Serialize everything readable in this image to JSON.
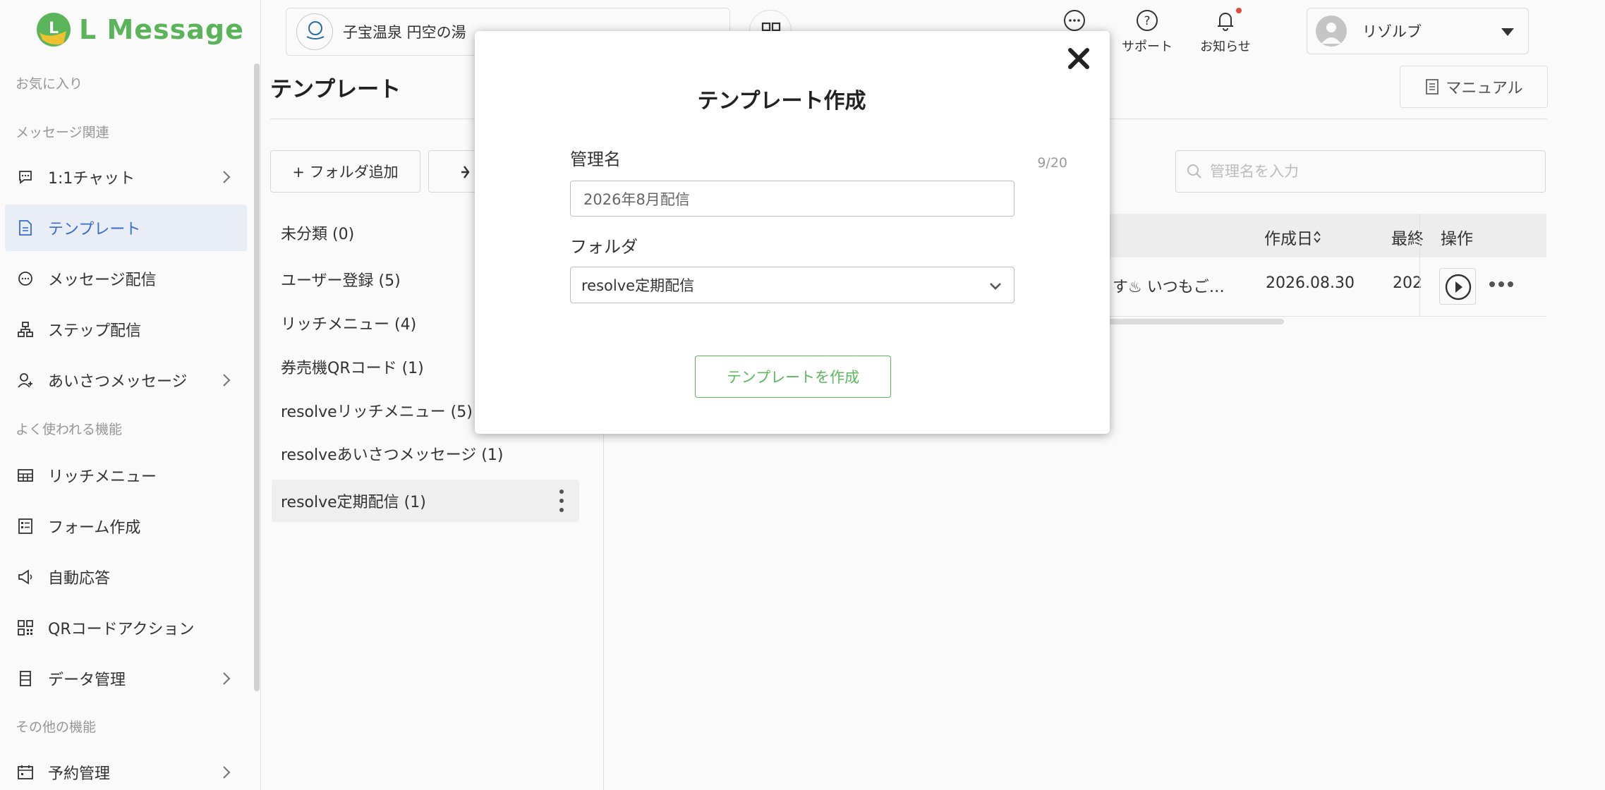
{
  "app": {
    "name": "L Message",
    "brand_color": "#5cb85c",
    "active_color": "#3b6fd6"
  },
  "header": {
    "store_name": "子宝温泉 円空の湯",
    "icons": [
      {
        "name": "chat-icon",
        "label": ""
      },
      {
        "name": "support-icon",
        "label": "サポート"
      },
      {
        "name": "notification-icon",
        "label": "お知らせ"
      }
    ],
    "user_name": "リゾルブ"
  },
  "sidebar": {
    "sections": {
      "favorites": "お気に入り",
      "message": "メッセージ関連",
      "common": "よく使われる機能",
      "other": "その他の機能"
    },
    "items": [
      {
        "label": "1:1チャット",
        "icon": "chat-bubble-icon",
        "chevron": true
      },
      {
        "label": "テンプレート",
        "icon": "document-icon",
        "active": true
      },
      {
        "label": "メッセージ配信",
        "icon": "message-icon"
      },
      {
        "label": "ステップ配信",
        "icon": "step-icon"
      },
      {
        "label": "あいさつメッセージ",
        "icon": "user-plus-icon",
        "chevron": true
      },
      {
        "label": "リッチメニュー",
        "icon": "grid-icon"
      },
      {
        "label": "フォーム作成",
        "icon": "form-icon"
      },
      {
        "label": "自動応答",
        "icon": "megaphone-icon"
      },
      {
        "label": "QRコードアクション",
        "icon": "qr-icon"
      },
      {
        "label": "データ管理",
        "icon": "database-icon",
        "chevron": true
      },
      {
        "label": "予約管理",
        "icon": "calendar-icon",
        "chevron": true
      }
    ]
  },
  "main": {
    "title": "テンプレート",
    "manual_label": "マニュアル",
    "add_folder_label": "+ フォルダ追加",
    "folders": [
      {
        "label": "未分類 (0)"
      },
      {
        "label": "ユーザー登録 (5)"
      },
      {
        "label": "リッチメニュー (4)"
      },
      {
        "label": "券売機QRコード (1)"
      },
      {
        "label": "resolveリッチメニュー (5)"
      },
      {
        "label": "resolveあいさつメッセージ (1)"
      },
      {
        "label": "resolve定期配信 (1)",
        "active": true
      }
    ],
    "search_placeholder": "管理名を入力",
    "table": {
      "headers": {
        "created": "作成日",
        "updated": "最終",
        "ops": "操作"
      },
      "row": {
        "content": "す♨ いつもご…",
        "created": "2026.08.30",
        "updated": "202"
      }
    }
  },
  "modal": {
    "title": "テンプレート作成",
    "name_label": "管理名",
    "name_count": "9/20",
    "name_value": "2026年8月配信",
    "folder_label": "フォルダ",
    "folder_value": "resolve定期配信",
    "create_label": "テンプレートを作成"
  }
}
